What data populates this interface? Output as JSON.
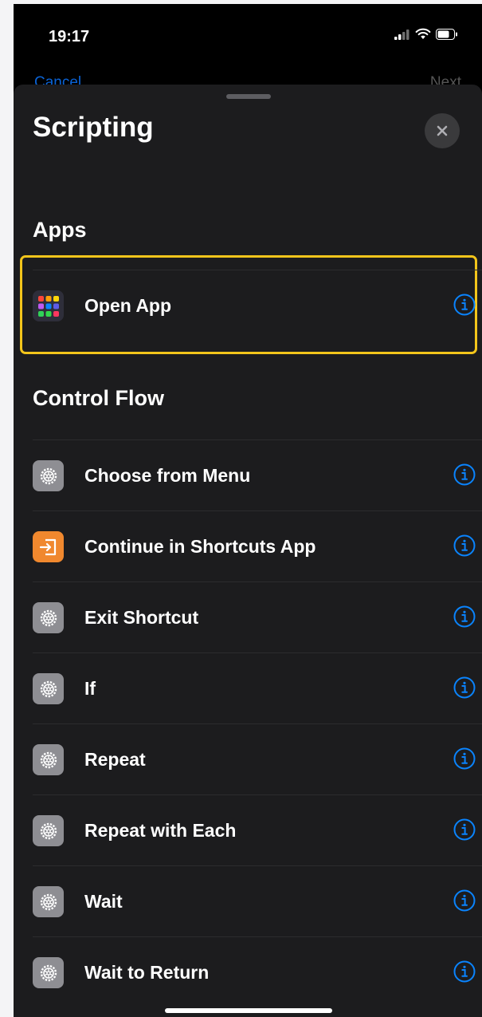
{
  "status": {
    "time": "19:17"
  },
  "background_nav": {
    "cancel": "Cancel",
    "next": "Next"
  },
  "sheet": {
    "title": "Scripting",
    "close_icon": "close-icon"
  },
  "sections": [
    {
      "header": "Apps",
      "items": [
        {
          "label": "Open App",
          "icon": "app-grid-icon",
          "highlighted": true
        }
      ]
    },
    {
      "header": "Control Flow",
      "items": [
        {
          "label": "Choose from Menu",
          "icon": "gear-icon"
        },
        {
          "label": "Continue in Shortcuts App",
          "icon": "shortcuts-app-icon"
        },
        {
          "label": "Exit Shortcut",
          "icon": "gear-icon"
        },
        {
          "label": "If",
          "icon": "gear-icon"
        },
        {
          "label": "Repeat",
          "icon": "gear-icon"
        },
        {
          "label": "Repeat with Each",
          "icon": "gear-icon"
        },
        {
          "label": "Wait",
          "icon": "gear-icon"
        },
        {
          "label": "Wait to Return",
          "icon": "gear-icon"
        }
      ]
    }
  ],
  "colors": {
    "accent_blue": "#0a84ff",
    "highlight_yellow": "#f3c51b",
    "sheet_bg": "#1c1c1e",
    "gear_icon_bg": "#8e8e93",
    "shortcuts_icon_bg": "#f0882e"
  }
}
